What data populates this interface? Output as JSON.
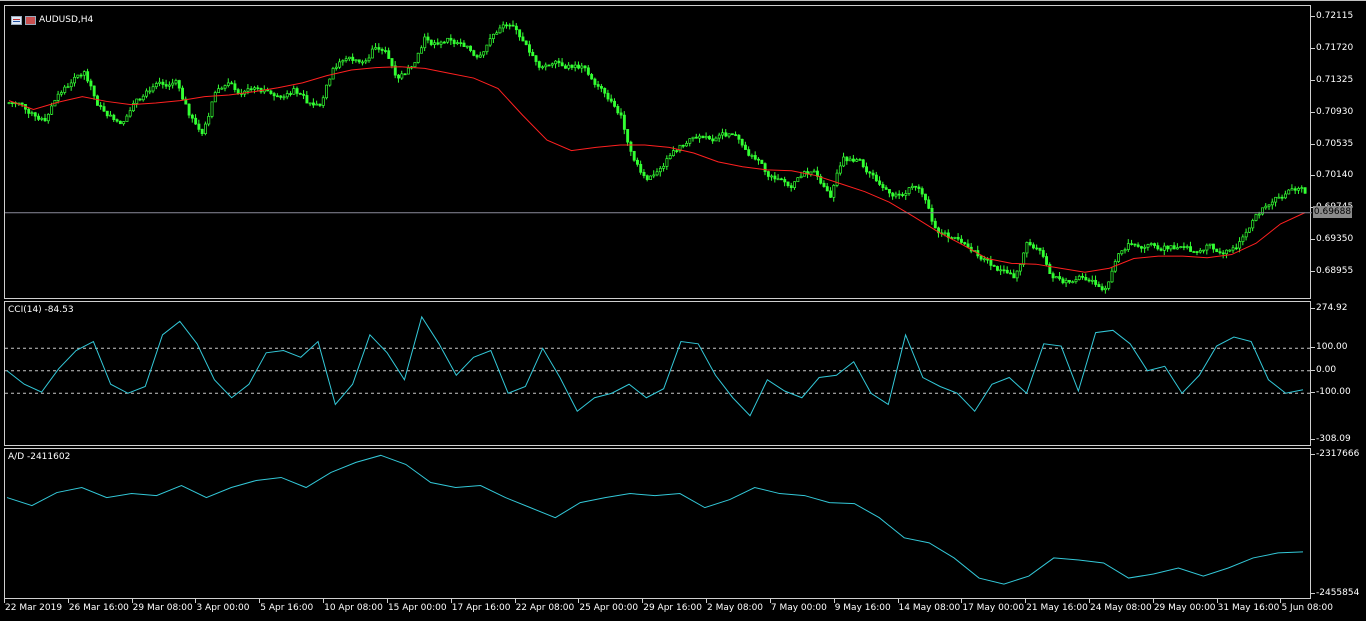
{
  "symbol_label": "AUDUSD,H4",
  "current_price": "0.69688",
  "main": {
    "y_labels": [
      "0.72115",
      "0.71720",
      "0.71325",
      "0.70930",
      "0.70535",
      "0.70140",
      "0.69745",
      "0.69350",
      "0.68955"
    ],
    "ylim": [
      0.6868,
      0.7218
    ]
  },
  "cci": {
    "label": "CCI(14) -84.53",
    "y_labels": [
      "274.92",
      "100.00",
      "0.00",
      "-100.00",
      "-308.09"
    ],
    "levels": [
      100,
      0,
      -100
    ],
    "ylim": [
      -308.09,
      274.92
    ]
  },
  "ad": {
    "label": "A/D -2411602",
    "y_labels": [
      "-2317666",
      "-2455854"
    ],
    "ylim": [
      -2455854,
      -2317666
    ]
  },
  "x_labels": [
    "22 Mar 2019",
    "26 Mar 16:00",
    "29 Mar 08:00",
    "3 Apr 00:00",
    "5 Apr 16:00",
    "10 Apr 08:00",
    "15 Apr 00:00",
    "17 Apr 16:00",
    "22 Apr 08:00",
    "25 Apr 00:00",
    "29 Apr 16:00",
    "2 May 08:00",
    "7 May 00:00",
    "9 May 16:00",
    "14 May 08:00",
    "17 May 00:00",
    "21 May 16:00",
    "24 May 08:00",
    "29 May 00:00",
    "31 May 16:00",
    "5 Jun 08:00"
  ],
  "colors": {
    "background": "#000000",
    "candle": "#33ff33",
    "ma": "#ff2020",
    "indicator": "#33c8d8",
    "level_line": "#c8c8c8",
    "price_line": "#8a8a9a"
  },
  "chart_data": [
    {
      "type": "line",
      "title": "AUDUSD,H4",
      "series": [
        {
          "name": "Close",
          "values": [
            0.7105,
            0.7093,
            0.7083,
            0.7116,
            0.713,
            0.7144,
            0.7102,
            0.709,
            0.7082,
            0.711,
            0.712,
            0.7128,
            0.7133,
            0.709,
            0.7067,
            0.7118,
            0.713,
            0.7116,
            0.7124,
            0.712,
            0.7112,
            0.7123,
            0.7105,
            0.7102,
            0.7148,
            0.716,
            0.7156,
            0.7172,
            0.717,
            0.7136,
            0.715,
            0.7187,
            0.7178,
            0.7183,
            0.7175,
            0.7162,
            0.7185,
            0.7202,
            0.7196,
            0.7168,
            0.715,
            0.7157,
            0.7152,
            0.7151,
            0.7128,
            0.711,
            0.709,
            0.7034,
            0.701,
            0.7024,
            0.7046,
            0.7055,
            0.7064,
            0.7058,
            0.7064,
            0.706,
            0.704,
            0.702,
            0.7011,
            0.7,
            0.702,
            0.7014,
            0.6988,
            0.7038,
            0.7035,
            0.7018,
            0.7,
            0.6992,
            0.7,
            0.6992,
            0.695,
            0.6938,
            0.6932,
            0.6922,
            0.691,
            0.6898,
            0.6888,
            0.6932,
            0.6922,
            0.6888,
            0.6885,
            0.689,
            0.6885,
            0.6875,
            0.6918,
            0.693,
            0.6926,
            0.6924,
            0.6928,
            0.6926,
            0.692,
            0.693,
            0.6918,
            0.6925,
            0.695,
            0.6975,
            0.6988,
            0.6997,
            0.7,
            0.6969
          ]
        },
        {
          "name": "Moving Average",
          "values": [
            0.7108,
            0.7097,
            0.7106,
            0.7113,
            0.7107,
            0.7103,
            0.7105,
            0.7108,
            0.7113,
            0.7115,
            0.7119,
            0.7124,
            0.713,
            0.7139,
            0.7146,
            0.7149,
            0.715,
            0.7148,
            0.7142,
            0.7136,
            0.7123,
            0.709,
            0.7059,
            0.7046,
            0.705,
            0.7053,
            0.7053,
            0.705,
            0.7043,
            0.7032,
            0.7026,
            0.7022,
            0.7021,
            0.7015,
            0.7005,
            0.6995,
            0.6982,
            0.6964,
            0.6945,
            0.6929,
            0.6912,
            0.6906,
            0.6905,
            0.69,
            0.6895,
            0.69,
            0.6912,
            0.6915,
            0.6915,
            0.6913,
            0.6917,
            0.6931,
            0.6955,
            0.6969
          ]
        }
      ],
      "ylim": [
        0.6868,
        0.7218
      ]
    },
    {
      "type": "line",
      "title": "CCI(14) -84.53",
      "series": [
        {
          "name": "CCI(14)",
          "values": [
            0,
            -60,
            -95,
            10,
            90,
            130,
            -60,
            -100,
            -70,
            160,
            220,
            120,
            -40,
            -120,
            -60,
            80,
            90,
            60,
            130,
            -150,
            -60,
            160,
            80,
            -40,
            240,
            120,
            -20,
            60,
            90,
            -100,
            -70,
            100,
            -30,
            -180,
            -120,
            -100,
            -60,
            -120,
            -80,
            130,
            120,
            -20,
            -120,
            -200,
            -40,
            -90,
            -120,
            -30,
            -20,
            40,
            -100,
            -150,
            160,
            -30,
            -70,
            -100,
            -180,
            -60,
            -30,
            -100,
            120,
            110,
            -90,
            170,
            180,
            120,
            0,
            20,
            -100,
            -20,
            110,
            150,
            130,
            -40,
            -100,
            -84.53
          ]
        }
      ],
      "levels": [
        100,
        0,
        -100
      ],
      "ylim": [
        -308.09,
        274.92
      ]
    },
    {
      "type": "line",
      "title": "A/D -2411602",
      "series": [
        {
          "name": "A/D",
          "values": [
            -2360000,
            -2368000,
            -2355000,
            -2350000,
            -2360000,
            -2356000,
            -2358000,
            -2348000,
            -2360000,
            -2350000,
            -2343000,
            -2340000,
            -2350000,
            -2335000,
            -2325000,
            -2318000,
            -2327000,
            -2345000,
            -2350000,
            -2348000,
            -2360000,
            -2370000,
            -2380000,
            -2365000,
            -2360000,
            -2356000,
            -2358000,
            -2356000,
            -2370000,
            -2362000,
            -2350000,
            -2356000,
            -2358000,
            -2365000,
            -2366000,
            -2380000,
            -2400000,
            -2405000,
            -2420000,
            -2440000,
            -2446000,
            -2438000,
            -2420000,
            -2422000,
            -2425000,
            -2440000,
            -2436000,
            -2430000,
            -2438000,
            -2430000,
            -2420000,
            -2415000,
            -2414000
          ]
        }
      ],
      "ylim": [
        -2455854,
        -2317666
      ]
    }
  ]
}
